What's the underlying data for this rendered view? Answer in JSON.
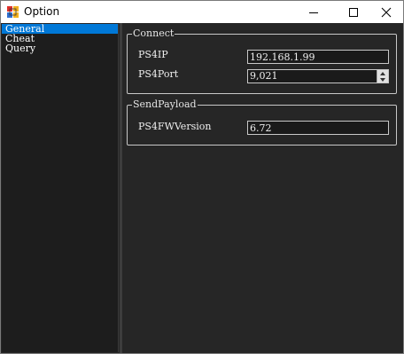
{
  "window": {
    "title": "Option"
  },
  "nav": {
    "items": [
      {
        "label": "General",
        "selected": true
      },
      {
        "label": "Cheat",
        "selected": false
      },
      {
        "label": "Query",
        "selected": false
      }
    ]
  },
  "connect": {
    "title": "Connect",
    "ip_label": "PS4IP",
    "ip_value": "192.168.1.99",
    "port_label": "PS4Port",
    "port_value": "9,021"
  },
  "payload": {
    "title": "SendPayload",
    "fw_label": "PS4FWVersion",
    "fw_value": "6.72"
  },
  "colors": {
    "background": "#252525",
    "selection": "#0078d7",
    "text": "#ffffff"
  }
}
